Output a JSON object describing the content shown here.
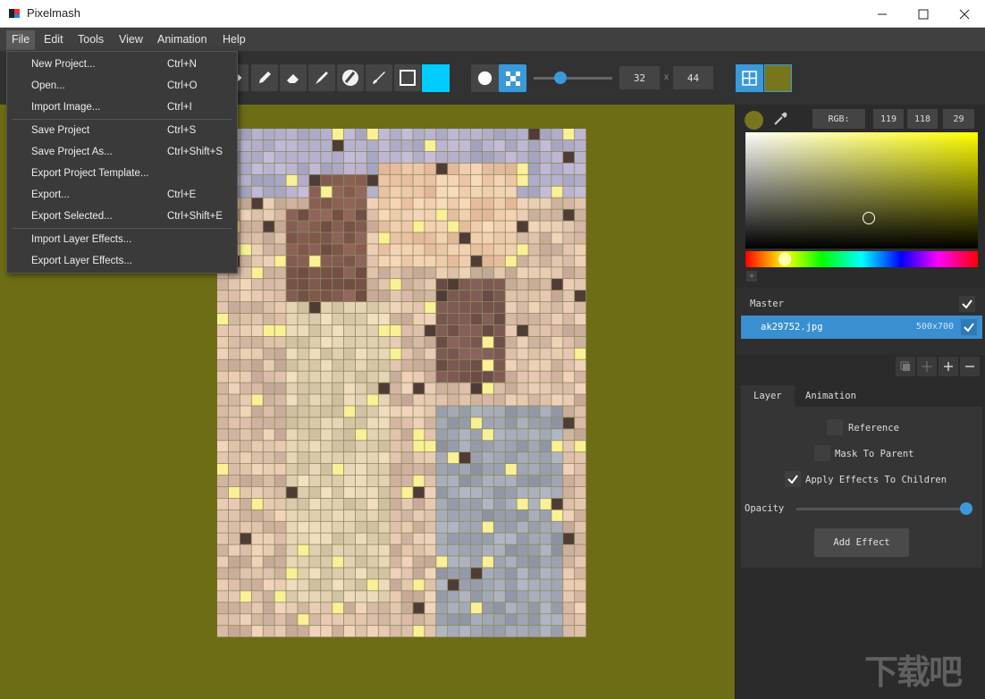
{
  "app": {
    "title": "Pixelmash"
  },
  "menubar": {
    "items": [
      "File",
      "Edit",
      "Tools",
      "View",
      "Animation",
      "Help"
    ]
  },
  "file_menu": {
    "items": [
      {
        "label": "New Project...",
        "shortcut": "Ctrl+N"
      },
      {
        "label": "Open...",
        "shortcut": "Ctrl+O"
      },
      {
        "label": "Import Image...",
        "shortcut": "Ctrl+I"
      },
      {
        "label": "Save Project",
        "shortcut": "Ctrl+S"
      },
      {
        "label": "Save Project As...",
        "shortcut": "Ctrl+Shift+S"
      },
      {
        "label": "Export Project Template...",
        "shortcut": ""
      },
      {
        "label": "Export...",
        "shortcut": "Ctrl+E"
      },
      {
        "label": "Export Selected...",
        "shortcut": "Ctrl+Shift+E"
      },
      {
        "label": "Import Layer Effects...",
        "shortcut": ""
      },
      {
        "label": "Export Layer Effects...",
        "shortcut": ""
      }
    ]
  },
  "toolbar": {
    "tools": [
      "move-icon",
      "pencil-icon",
      "eraser-icon",
      "brush-icon",
      "fill-icon",
      "smudge-icon",
      "rectangle-icon"
    ],
    "active_color": "#00ccff",
    "brush_shape": "round",
    "width": "32",
    "times": "x",
    "height": "44",
    "brush_size_fraction": 0.35,
    "view_background_color": "#77761d"
  },
  "canvas": {
    "background": "#6d6d16"
  },
  "color_panel": {
    "current_color": "#77761d",
    "rgb_label": "RGB:",
    "r": "119",
    "g": "118",
    "b": "29",
    "hue_fraction": 0.17
  },
  "layers": {
    "master_label": "Master",
    "master_visible": true,
    "items": [
      {
        "name": "ak29752.jpg",
        "size": "500x700",
        "visible": true
      }
    ]
  },
  "tabs": {
    "layer": "Layer",
    "animation": "Animation"
  },
  "layer_options": {
    "reference": {
      "label": "Reference",
      "checked": false
    },
    "mask": {
      "label": "Mask To Parent",
      "checked": false
    },
    "apply_effects": {
      "label": "Apply Effects To Children",
      "checked": true
    },
    "opacity_label": "Opacity",
    "opacity": 1.0,
    "add_effect": "Add Effect"
  }
}
